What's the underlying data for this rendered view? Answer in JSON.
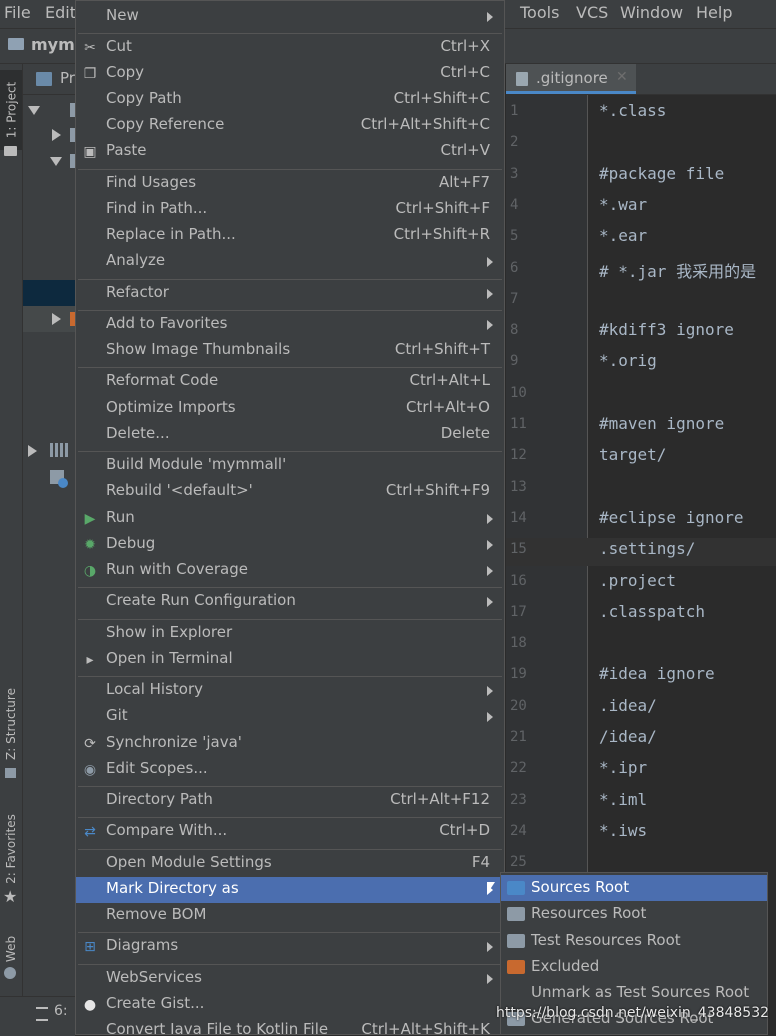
{
  "menubar": {
    "file": "File",
    "edit": "Edit",
    "tools": "Tools",
    "vcs": "VCS",
    "window": "Window",
    "help": "Help"
  },
  "navbar": {
    "project_name": "mymm"
  },
  "left_strip": {
    "project_tab": "1: Project",
    "structure_tab": "Z: Structure",
    "favorites_tab": "2: Favorites",
    "web_tab": "Web"
  },
  "project_panel": {
    "header_label": "Pr"
  },
  "bottom_bar": {
    "todo_tab": "6:"
  },
  "editor": {
    "tab_label": ".gitignore",
    "current_line": 15,
    "lines": [
      {
        "n": "1",
        "text": "*.class"
      },
      {
        "n": "2",
        "text": ""
      },
      {
        "n": "3",
        "text": "#package file"
      },
      {
        "n": "4",
        "text": "*.war"
      },
      {
        "n": "5",
        "text": "*.ear"
      },
      {
        "n": "6",
        "text": "# *.jar  我采用的是"
      },
      {
        "n": "7",
        "text": ""
      },
      {
        "n": "8",
        "text": "#kdiff3 ignore"
      },
      {
        "n": "9",
        "text": "*.orig"
      },
      {
        "n": "10",
        "text": ""
      },
      {
        "n": "11",
        "text": "#maven ignore"
      },
      {
        "n": "12",
        "text": "target/"
      },
      {
        "n": "13",
        "text": ""
      },
      {
        "n": "14",
        "text": "#eclipse ignore"
      },
      {
        "n": "15",
        "text": ".settings/"
      },
      {
        "n": "16",
        "text": ".project"
      },
      {
        "n": "17",
        "text": ".classpatch"
      },
      {
        "n": "18",
        "text": ""
      },
      {
        "n": "19",
        "text": "#idea ignore"
      },
      {
        "n": "20",
        "text": ".idea/"
      },
      {
        "n": "21",
        "text": "/idea/"
      },
      {
        "n": "22",
        "text": "*.ipr"
      },
      {
        "n": "23",
        "text": "*.iml"
      },
      {
        "n": "24",
        "text": "*.iws"
      },
      {
        "n": "25",
        "text": ""
      }
    ]
  },
  "context_menu": {
    "items": [
      {
        "label": "New",
        "shortcut": "",
        "submenu": true,
        "icon": ""
      },
      {
        "label": "Cut",
        "shortcut": "Ctrl+X",
        "submenu": false,
        "icon": "scissors-icon"
      },
      {
        "label": "Copy",
        "shortcut": "Ctrl+C",
        "submenu": false,
        "icon": "copy-icon"
      },
      {
        "label": "Copy Path",
        "shortcut": "Ctrl+Shift+C",
        "submenu": false,
        "icon": ""
      },
      {
        "label": "Copy Reference",
        "shortcut": "Ctrl+Alt+Shift+C",
        "submenu": false,
        "icon": ""
      },
      {
        "label": "Paste",
        "shortcut": "Ctrl+V",
        "submenu": false,
        "icon": "paste-icon"
      },
      {
        "label": "Find Usages",
        "shortcut": "Alt+F7",
        "submenu": false,
        "icon": ""
      },
      {
        "label": "Find in Path...",
        "shortcut": "Ctrl+Shift+F",
        "submenu": false,
        "icon": ""
      },
      {
        "label": "Replace in Path...",
        "shortcut": "Ctrl+Shift+R",
        "submenu": false,
        "icon": ""
      },
      {
        "label": "Analyze",
        "shortcut": "",
        "submenu": true,
        "icon": ""
      },
      {
        "label": "Refactor",
        "shortcut": "",
        "submenu": true,
        "icon": ""
      },
      {
        "label": "Add to Favorites",
        "shortcut": "",
        "submenu": true,
        "icon": ""
      },
      {
        "label": "Show Image Thumbnails",
        "shortcut": "Ctrl+Shift+T",
        "submenu": false,
        "icon": ""
      },
      {
        "label": "Reformat Code",
        "shortcut": "Ctrl+Alt+L",
        "submenu": false,
        "icon": ""
      },
      {
        "label": "Optimize Imports",
        "shortcut": "Ctrl+Alt+O",
        "submenu": false,
        "icon": ""
      },
      {
        "label": "Delete...",
        "shortcut": "Delete",
        "submenu": false,
        "icon": ""
      },
      {
        "label": "Build Module 'mymmall'",
        "shortcut": "",
        "submenu": false,
        "icon": ""
      },
      {
        "label": "Rebuild '<default>'",
        "shortcut": "Ctrl+Shift+F9",
        "submenu": false,
        "icon": ""
      },
      {
        "label": "Run",
        "shortcut": "",
        "submenu": true,
        "icon": "run-icon"
      },
      {
        "label": "Debug",
        "shortcut": "",
        "submenu": true,
        "icon": "debug-icon"
      },
      {
        "label": "Run with Coverage",
        "shortcut": "",
        "submenu": true,
        "icon": "coverage-icon"
      },
      {
        "label": "Create Run Configuration",
        "shortcut": "",
        "submenu": true,
        "icon": ""
      },
      {
        "label": "Show in Explorer",
        "shortcut": "",
        "submenu": false,
        "icon": ""
      },
      {
        "label": "Open in Terminal",
        "shortcut": "",
        "submenu": false,
        "icon": "terminal-icon"
      },
      {
        "label": "Local History",
        "shortcut": "",
        "submenu": true,
        "icon": ""
      },
      {
        "label": "Git",
        "shortcut": "",
        "submenu": true,
        "icon": ""
      },
      {
        "label": "Synchronize 'java'",
        "shortcut": "",
        "submenu": false,
        "icon": "sync-icon"
      },
      {
        "label": "Edit Scopes...",
        "shortcut": "",
        "submenu": false,
        "icon": "scopes-icon"
      },
      {
        "label": "Directory Path",
        "shortcut": "Ctrl+Alt+F12",
        "submenu": false,
        "icon": ""
      },
      {
        "label": "Compare With...",
        "shortcut": "Ctrl+D",
        "submenu": false,
        "icon": "compare-icon"
      },
      {
        "label": "Open Module Settings",
        "shortcut": "F4",
        "submenu": false,
        "icon": ""
      },
      {
        "label": "Mark Directory as",
        "shortcut": "",
        "submenu": true,
        "icon": "",
        "selected": true
      },
      {
        "label": "Remove BOM",
        "shortcut": "",
        "submenu": false,
        "icon": ""
      },
      {
        "label": "Diagrams",
        "shortcut": "",
        "submenu": true,
        "icon": "diagrams-icon"
      },
      {
        "label": "WebServices",
        "shortcut": "",
        "submenu": true,
        "icon": ""
      },
      {
        "label": "Create Gist...",
        "shortcut": "",
        "submenu": false,
        "icon": "github-icon"
      },
      {
        "label": "Convert Java File to Kotlin File",
        "shortcut": "Ctrl+Alt+Shift+K",
        "submenu": false,
        "icon": ""
      }
    ]
  },
  "submenu": {
    "items": [
      {
        "label": "Sources Root",
        "folder_color": "#4a88c7",
        "selected": true
      },
      {
        "label": "Resources Root",
        "folder_color": "#8d9aa6"
      },
      {
        "label": "Test Resources Root",
        "folder_color": "#8d9aa6"
      },
      {
        "label": "Excluded",
        "folder_color": "#c8692f"
      },
      {
        "label": "Unmark as Test Sources Root",
        "folder_color": ""
      },
      {
        "label": "Generated Sources Root",
        "folder_color": "#8d9aa6"
      }
    ]
  },
  "watermark": "https://blog.csdn.net/weixin_43848532"
}
